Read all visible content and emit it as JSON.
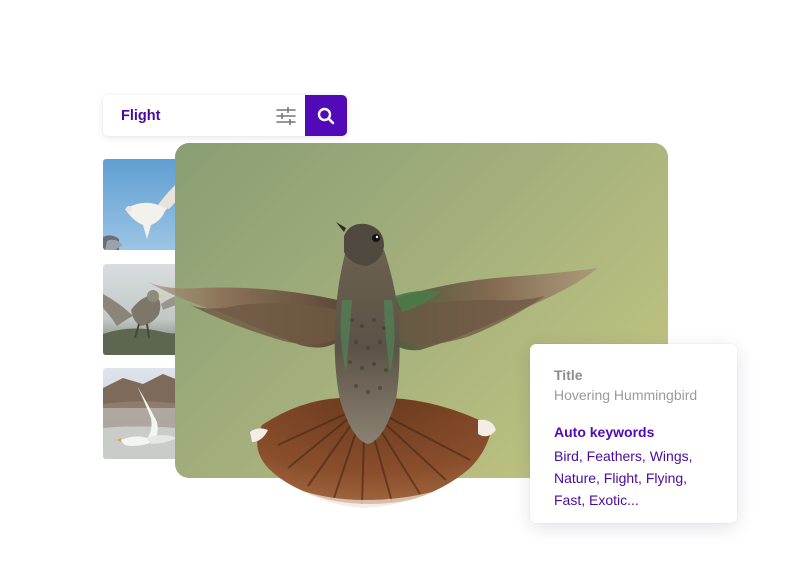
{
  "search": {
    "query": "Flight",
    "filter_icon": "sliders-icon",
    "search_icon": "search-icon",
    "accent_color": "#5209b7"
  },
  "thumbnails": [
    {
      "subject": "white dove in flight"
    },
    {
      "subject": "bird landing"
    },
    {
      "subject": "seagull in flight"
    }
  ],
  "main_image": {
    "subject": "hovering hummingbird"
  },
  "info_card": {
    "title_label": "Title",
    "title_value": "Hovering Hummingbird",
    "keywords_label": "Auto keywords",
    "keywords_value": "Bird, Feathers, Wings, Nature, Flight, Flying, Fast, Exotic..."
  }
}
